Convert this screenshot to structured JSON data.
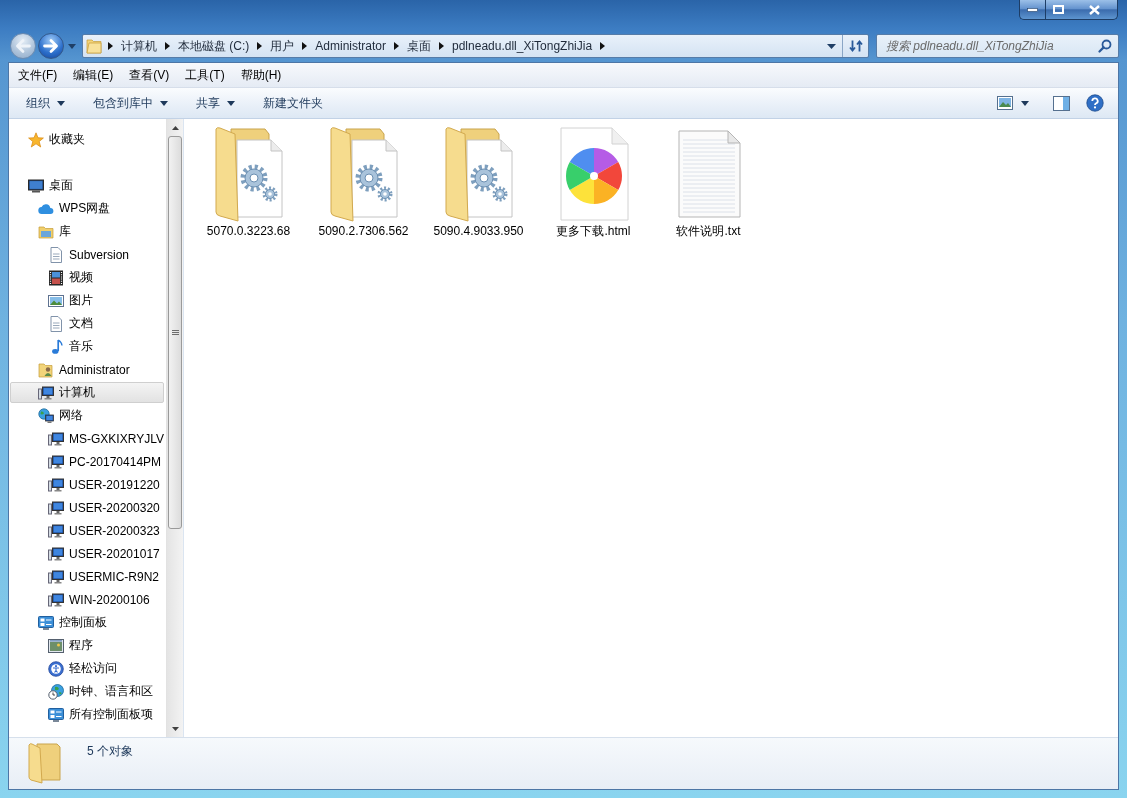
{
  "navigation": [
    {
      "kind": "back",
      "disabled": true
    },
    {
      "kind": "forward",
      "disabled": false
    }
  ],
  "address_bar": {
    "breadcrumbs": [
      "计算机",
      "本地磁盘 (C:)",
      "用户",
      "Administrator",
      "桌面",
      "pdlneadu.dll_XiTongZhiJia"
    ]
  },
  "search": {
    "placeholder": "搜索 pdlneadu.dll_XiTongZhiJia"
  },
  "menu_bar": [
    "文件(F)",
    "编辑(E)",
    "查看(V)",
    "工具(T)",
    "帮助(H)"
  ],
  "toolbar": {
    "buttons": [
      {
        "label": "组织",
        "dropdown": true
      },
      {
        "label": "包含到库中",
        "dropdown": true
      },
      {
        "label": "共享",
        "dropdown": true
      },
      {
        "label": "新建文件夹",
        "dropdown": false
      }
    ]
  },
  "sidebar": {
    "items": [
      {
        "label": "收藏夹",
        "selected": false
      },
      {
        "label": "桌面",
        "selected": false,
        "children": [
          {
            "label": "WPS网盘",
            "selected": false
          },
          {
            "label": "库",
            "selected": false,
            "children": [
              {
                "label": "Subversion",
                "selected": false
              },
              {
                "label": "视频",
                "selected": false
              },
              {
                "label": "图片",
                "selected": false
              },
              {
                "label": "文档",
                "selected": false
              },
              {
                "label": "音乐",
                "selected": false
              }
            ]
          },
          {
            "label": "Administrator",
            "selected": false
          },
          {
            "label": "计算机",
            "selected": true
          },
          {
            "label": "网络",
            "selected": false,
            "children": [
              {
                "label": "MS-GXKIXRYJLV",
                "selected": false
              },
              {
                "label": "PC-20170414PM",
                "selected": false
              },
              {
                "label": "USER-20191220",
                "selected": false
              },
              {
                "label": "USER-20200320",
                "selected": false
              },
              {
                "label": "USER-20200323",
                "selected": false
              },
              {
                "label": "USER-20201017",
                "selected": false
              },
              {
                "label": "USERMIC-R9N2",
                "selected": false
              },
              {
                "label": "WIN-20200106",
                "selected": false
              }
            ]
          },
          {
            "label": "控制面板",
            "selected": false,
            "children": [
              {
                "label": "程序",
                "selected": false
              },
              {
                "label": "轻松访问",
                "selected": false
              },
              {
                "label": "时钟、语言和区",
                "selected": false
              },
              {
                "label": "所有控制面板项",
                "selected": false
              }
            ]
          }
        ]
      }
    ]
  },
  "files": [
    {
      "name": "5070.0.3223.68",
      "kind": "folder",
      "selected": false
    },
    {
      "name": "5090.2.7306.562",
      "kind": "folder",
      "selected": false
    },
    {
      "name": "5090.4.9033.950",
      "kind": "folder",
      "selected": false
    },
    {
      "name": "更多下载.html",
      "kind": "html",
      "selected": false
    },
    {
      "name": "软件说明.txt",
      "kind": "txt",
      "selected": false
    }
  ],
  "status_bar": {
    "text": "5 个对象"
  }
}
